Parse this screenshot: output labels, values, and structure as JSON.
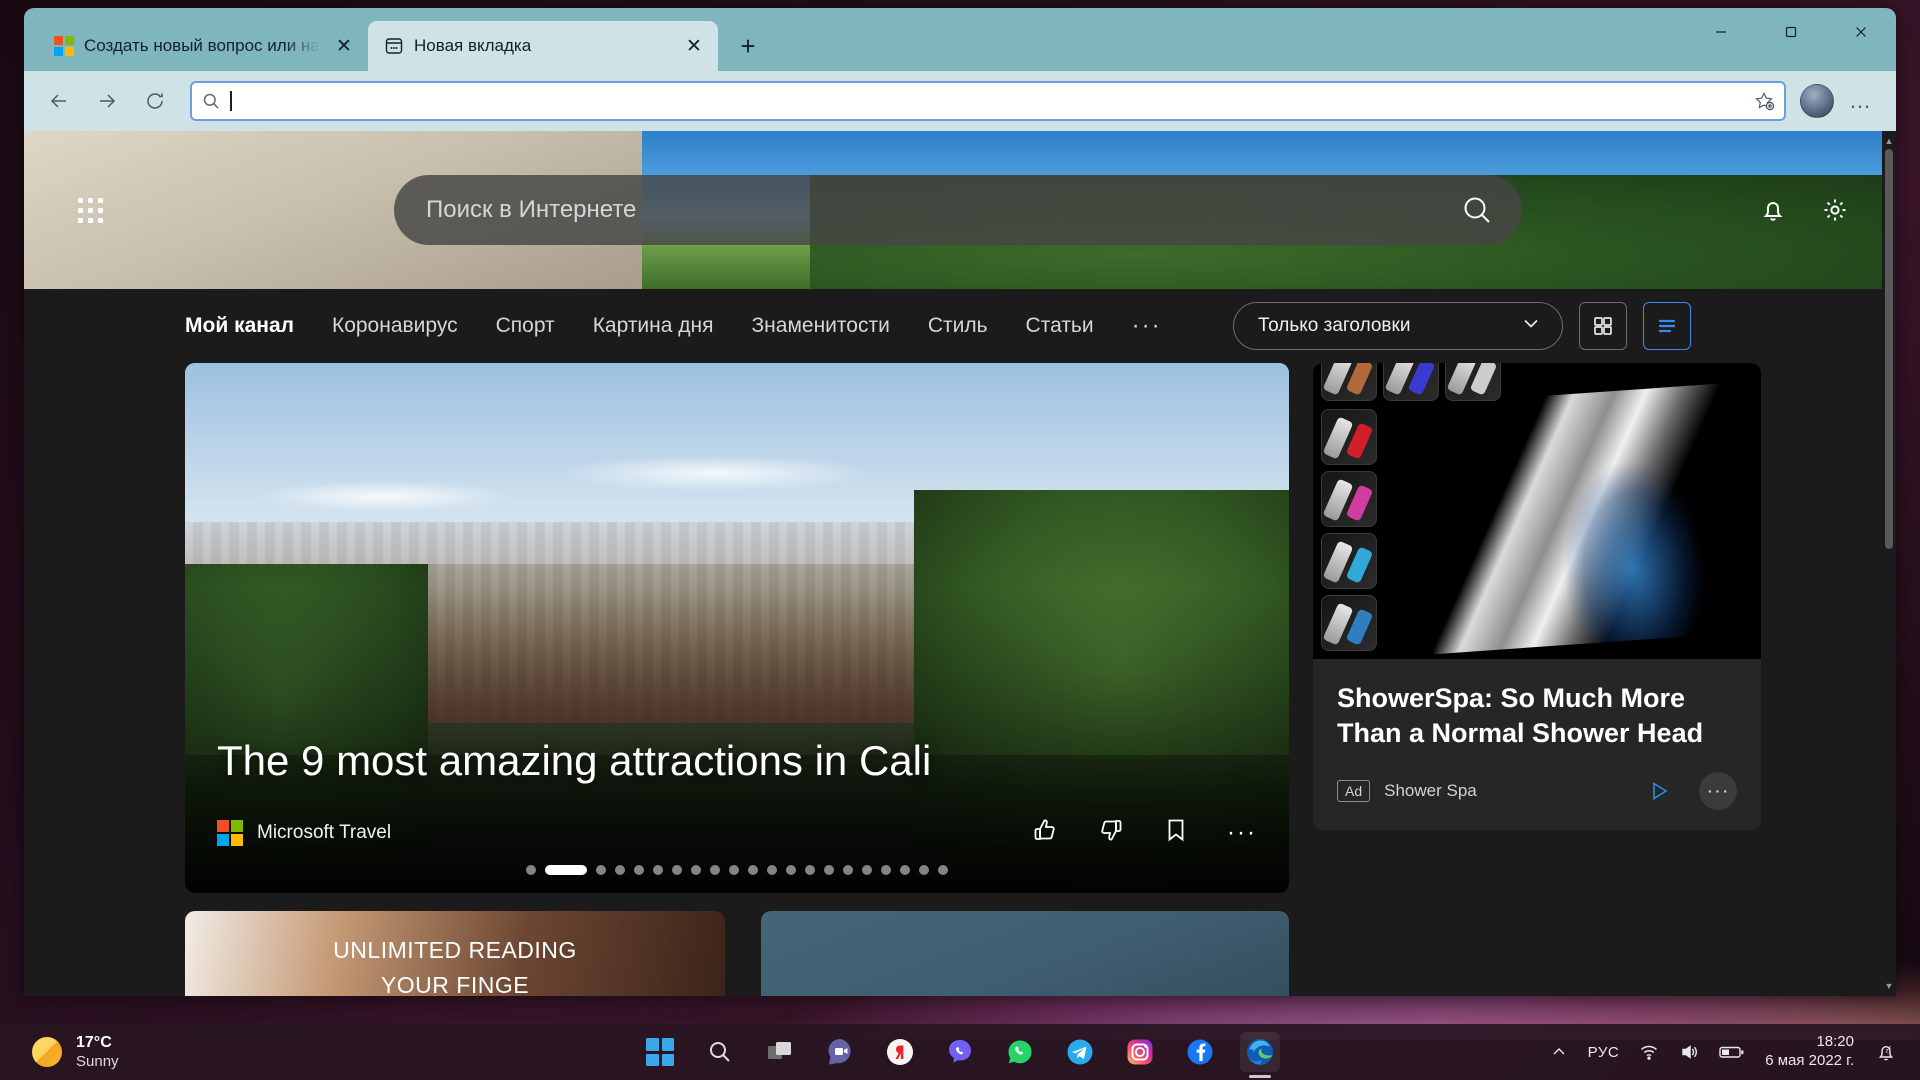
{
  "browser": {
    "tabs": [
      {
        "title": "Создать новый вопрос или нач",
        "favicon": "microsoft-logo-icon",
        "active": false,
        "close_label": "✕"
      },
      {
        "title": "Новая вкладка",
        "favicon": "new-tab-page-icon",
        "active": true,
        "close_label": "✕"
      }
    ],
    "new_tab_label": "+",
    "window_controls": {
      "minimize": "—",
      "maximize": "▢",
      "close": "✕"
    },
    "toolbar": {
      "back": "back-arrow-icon",
      "forward": "forward-arrow-icon",
      "refresh": "refresh-icon",
      "address_value": "",
      "address_placeholder": "",
      "favorite": "add-favorite-icon",
      "settings_more": "…"
    },
    "accent_focus_color": "#6a9fe0",
    "tab_bar_color": "#7fb5bd",
    "toolbar_color": "#cfe3e6"
  },
  "msn": {
    "search": {
      "placeholder": "Поиск в Интернете",
      "value": ""
    },
    "waffle": "app-launcher-icon",
    "notifications_icon": "bell-icon",
    "settings_icon": "gear-icon",
    "nav": [
      {
        "label": "Мой канал",
        "active": true
      },
      {
        "label": "Коронавирус",
        "active": false
      },
      {
        "label": "Спорт",
        "active": false
      },
      {
        "label": "Картина дня",
        "active": false
      },
      {
        "label": "Знаменитости",
        "active": false
      },
      {
        "label": "Стиль",
        "active": false
      },
      {
        "label": "Статьи",
        "active": false
      }
    ],
    "nav_more": "···",
    "layout_select": {
      "value": "Только заголовки",
      "chevron": "⌄"
    },
    "view_grid_icon": "grid-view-icon",
    "view_list_icon": "list-view-icon",
    "hero": {
      "title": "The 9 most amazing attractions in Cali",
      "source": "Microsoft Travel",
      "like_icon": "thumbs-up-icon",
      "dislike_icon": "thumbs-down-icon",
      "save_icon": "bookmark-icon",
      "more_icon": "···",
      "carousel_total": 21,
      "carousel_active_index": 1
    },
    "lower_cards": [
      {
        "text": "UNLIMITED READING\nYOUR FINGE"
      },
      {
        "text": ""
      }
    ],
    "ad": {
      "title": "ShowerSpa: So Much More Than a Normal Shower Head",
      "badge": "Ad",
      "brand": "Shower Spa",
      "adchoices_icon": "adchoices-icon",
      "more_icon": "···",
      "thumb_colors": [
        "#b06a3c",
        "#3a3ad0",
        "#cccccc",
        "#d01f2a",
        "#d03ca0",
        "#30a8d8",
        "#2f7fc0"
      ]
    }
  },
  "taskbar": {
    "weather": {
      "temp": "17°C",
      "condition": "Sunny",
      "icon": "sun-icon"
    },
    "apps": [
      {
        "name": "start-button",
        "icon": "windows-logo-icon",
        "active": false
      },
      {
        "name": "search-button",
        "icon": "search-icon",
        "active": false
      },
      {
        "name": "task-view-button",
        "icon": "task-view-icon",
        "active": false
      },
      {
        "name": "teams-button",
        "icon": "teams-icon",
        "active": false
      },
      {
        "name": "yandex-button",
        "icon": "yandex-icon",
        "active": false
      },
      {
        "name": "viber-button",
        "icon": "viber-icon",
        "active": false
      },
      {
        "name": "whatsapp-button",
        "icon": "whatsapp-icon",
        "active": false
      },
      {
        "name": "telegram-button",
        "icon": "telegram-icon",
        "active": false
      },
      {
        "name": "instagram-button",
        "icon": "instagram-icon",
        "active": false
      },
      {
        "name": "facebook-button",
        "icon": "facebook-icon",
        "active": false
      },
      {
        "name": "edge-button",
        "icon": "edge-icon",
        "active": true
      }
    ],
    "tray": {
      "overflow": "⌃",
      "language": "РУС",
      "network_icon": "wifi-icon",
      "volume_icon": "speaker-icon",
      "battery_icon": "battery-icon",
      "time": "18:20",
      "date": "6 мая 2022 г.",
      "notifications_icon": "do-not-disturb-bell-icon"
    }
  }
}
